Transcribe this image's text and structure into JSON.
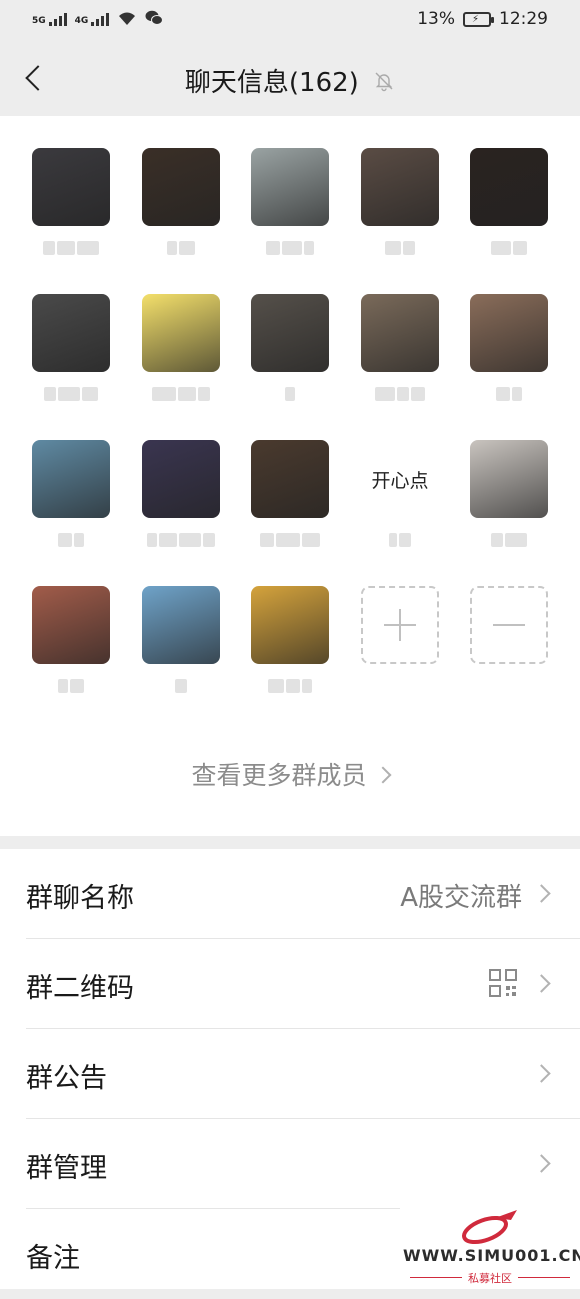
{
  "status_bar": {
    "sim1_label": "5G",
    "sim2_label": "4G",
    "battery": "13%",
    "time": "12:29"
  },
  "nav": {
    "title": "聊天信息(162)",
    "back_icon": "chevron-left-icon",
    "mute_icon": "bell-muted-icon"
  },
  "members": [
    {
      "name": "",
      "avatar_color": "#3b3a3e"
    },
    {
      "name": "",
      "avatar_color": "#3a2f27"
    },
    {
      "name": "",
      "avatar_color": "#9aa3a3"
    },
    {
      "name": "",
      "avatar_color": "#5a4c44"
    },
    {
      "name": "",
      "avatar_color": "#2a2320"
    },
    {
      "name": "",
      "avatar_color": "#4a4a4a"
    },
    {
      "name": "",
      "avatar_color": "#f4e06b"
    },
    {
      "name": "",
      "avatar_color": "#55504a"
    },
    {
      "name": "",
      "avatar_color": "#7a6a5a"
    },
    {
      "name": "",
      "avatar_color": "#8a6d5a"
    },
    {
      "name": "",
      "avatar_color": "#5f8aa3"
    },
    {
      "name": "",
      "avatar_color": "#3a3550"
    },
    {
      "name": "",
      "avatar_color": "#4a3a2e"
    },
    {
      "name": "开心点",
      "avatar_color": "#ffffff"
    },
    {
      "name": "",
      "avatar_color": "#c9c4bf"
    },
    {
      "name": "",
      "avatar_color": "#a25c4a"
    },
    {
      "name": "",
      "avatar_color": "#6fa3c9"
    },
    {
      "name": "",
      "avatar_color": "#d5a33c"
    }
  ],
  "more_members": "查看更多群成员",
  "settings": {
    "group_name_label": "群聊名称",
    "group_name_value": "A股交流群",
    "qr_label": "群二维码",
    "notice_label": "群公告",
    "manage_label": "群管理",
    "remark_label": "备注"
  },
  "watermark": {
    "text": "WWW.SIMU001.CN",
    "sub": "私募社区"
  }
}
